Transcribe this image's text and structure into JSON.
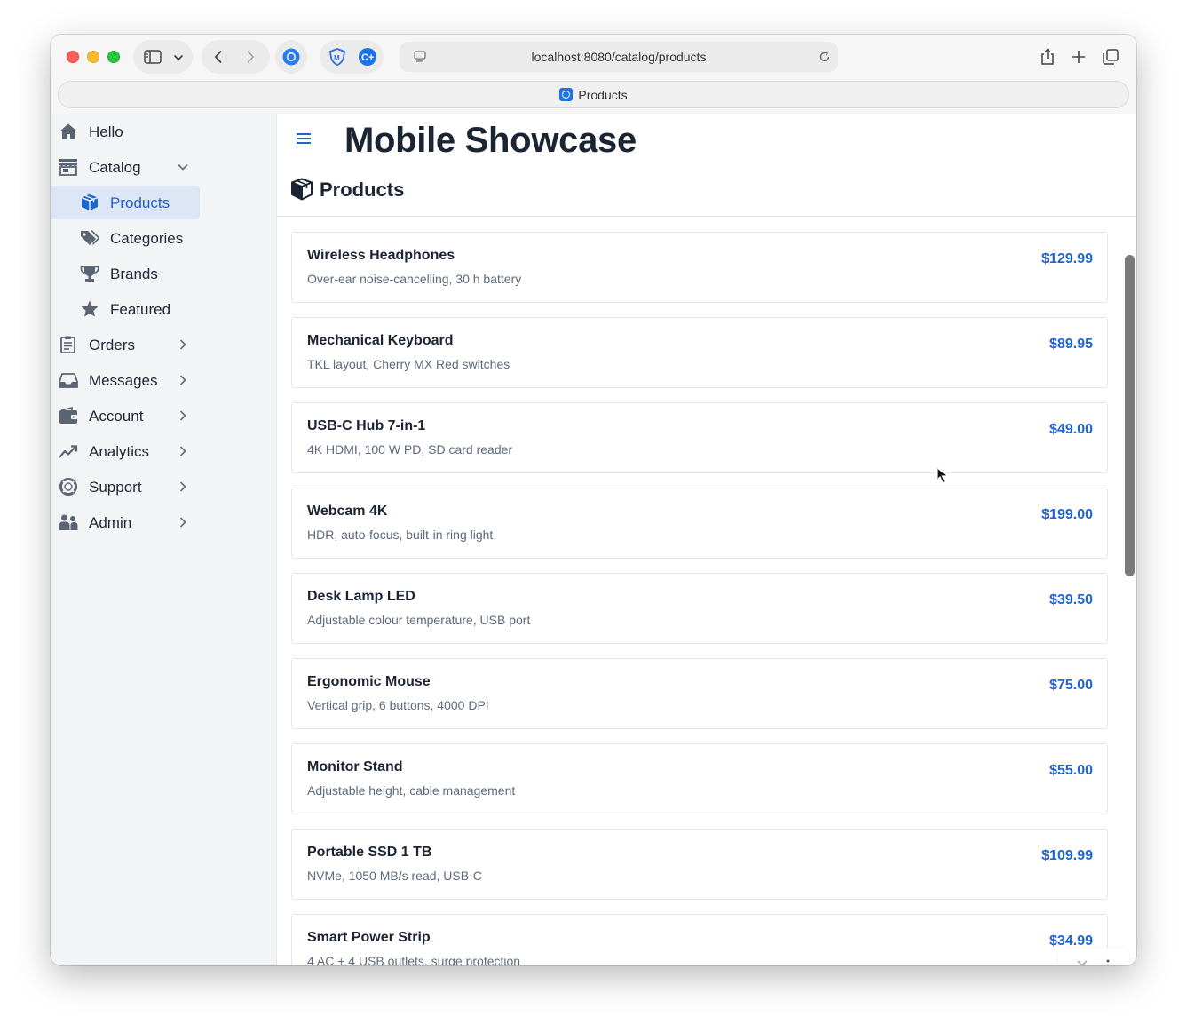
{
  "browser": {
    "url": "localhost:8080/catalog/products",
    "tab_title": "Products"
  },
  "sidebar": {
    "items": [
      {
        "label": "Hello",
        "icon": "home-icon"
      },
      {
        "label": "Catalog",
        "icon": "store-icon",
        "expanded": true
      },
      {
        "label": "Orders",
        "icon": "clipboard-icon"
      },
      {
        "label": "Messages",
        "icon": "inbox-icon"
      },
      {
        "label": "Account",
        "icon": "wallet-icon"
      },
      {
        "label": "Analytics",
        "icon": "chart-line-icon"
      },
      {
        "label": "Support",
        "icon": "lifebuoy-icon"
      },
      {
        "label": "Admin",
        "icon": "users-icon"
      }
    ],
    "catalog_children": [
      {
        "label": "Products",
        "icon": "box-icon",
        "active": true
      },
      {
        "label": "Categories",
        "icon": "tags-icon"
      },
      {
        "label": "Brands",
        "icon": "trophy-icon"
      },
      {
        "label": "Featured",
        "icon": "star-icon"
      }
    ]
  },
  "header": {
    "app_title": "Mobile Showcase",
    "section_title": "Products"
  },
  "products": [
    {
      "name": "Wireless Headphones",
      "description": "Over-ear noise-cancelling, 30 h battery",
      "price": "$129.99"
    },
    {
      "name": "Mechanical Keyboard",
      "description": "TKL layout, Cherry MX Red switches",
      "price": "$89.95"
    },
    {
      "name": "USB-C Hub 7-in-1",
      "description": "4K HDMI, 100 W PD, SD card reader",
      "price": "$49.00"
    },
    {
      "name": "Webcam 4K",
      "description": "HDR, auto-focus, built-in ring light",
      "price": "$199.00"
    },
    {
      "name": "Desk Lamp LED",
      "description": "Adjustable colour temperature, USB port",
      "price": "$39.50"
    },
    {
      "name": "Ergonomic Mouse",
      "description": "Vertical grip, 6 buttons, 4000 DPI",
      "price": "$75.00"
    },
    {
      "name": "Monitor Stand",
      "description": "Adjustable height, cable management",
      "price": "$55.00"
    },
    {
      "name": "Portable SSD 1 TB",
      "description": "NVMe, 1050 MB/s read, USB-C",
      "price": "$109.99"
    },
    {
      "name": "Smart Power Strip",
      "description": "4 AC + 4 USB outlets, surge protection",
      "price": "$34.99"
    }
  ],
  "colors": {
    "accent": "#1f66d1",
    "active_bg": "#dde6f5",
    "sidebar_bg": "#f3f4f6"
  }
}
